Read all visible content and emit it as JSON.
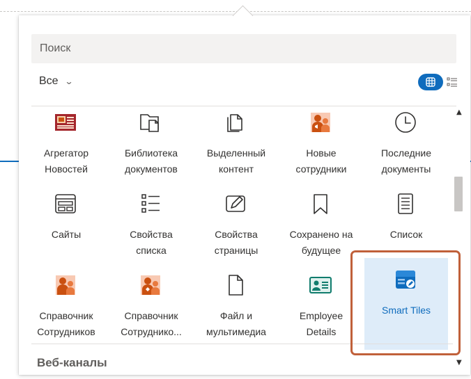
{
  "search": {
    "placeholder": "Поиск"
  },
  "filter": {
    "label": "Все"
  },
  "tiles": [
    {
      "label1": "Агрегатор",
      "label2": "Новостей",
      "icon": "news-aggregator-icon"
    },
    {
      "label1": "Библиотека",
      "label2": "документов",
      "icon": "document-library-icon"
    },
    {
      "label1": "Выделенный",
      "label2": "контент",
      "icon": "highlighted-content-icon"
    },
    {
      "label1": "Новые",
      "label2": "сотрудники",
      "icon": "new-employees-icon"
    },
    {
      "label1": "Последние",
      "label2": "документы",
      "icon": "clock-icon"
    },
    {
      "label1": "Сайты",
      "label2": "",
      "icon": "sites-icon"
    },
    {
      "label1": "Свойства",
      "label2": "списка",
      "icon": "list-properties-icon"
    },
    {
      "label1": "Свойства",
      "label2": "страницы",
      "icon": "page-properties-icon"
    },
    {
      "label1": "Сохранено на",
      "label2": "будущее",
      "icon": "bookmark-icon"
    },
    {
      "label1": "Список",
      "label2": "",
      "icon": "list-icon"
    },
    {
      "label1": "Справочник",
      "label2": "Сотрудников",
      "icon": "employee-directory-icon"
    },
    {
      "label1": "Справочник",
      "label2": "Сотруднико...",
      "icon": "employee-directory-2-icon"
    },
    {
      "label1": "Файл и",
      "label2": "мультимедиа",
      "icon": "file-media-icon"
    },
    {
      "label1": "Employee",
      "label2": "Details",
      "icon": "employee-details-icon"
    },
    {
      "label1": "Smart Tiles",
      "label2": "",
      "icon": "smart-tiles-icon"
    }
  ],
  "section": {
    "title": "Веб-каналы"
  },
  "colors": {
    "accent": "#0f6cbd",
    "highlight_frame": "#c0603a",
    "selected_bg": "#deecf9"
  }
}
